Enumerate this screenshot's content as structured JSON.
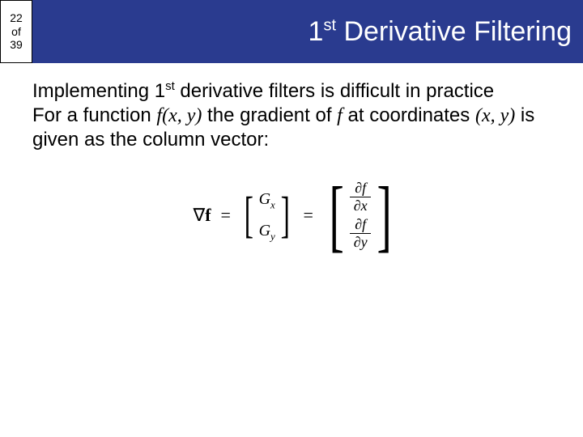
{
  "page_counter": {
    "current": "22",
    "of": "of",
    "total": "39"
  },
  "title": {
    "base1": "1",
    "sup": "st",
    "rest": " Derivative Filtering"
  },
  "body": {
    "line1a": "Implementing 1",
    "line1sup": "st",
    "line1b": " derivative filters is difficult in practice",
    "line2a": "For a function ",
    "fxy1": "f(x, y)",
    "line2b": " the gradient of ",
    "fsingle": "f",
    "line2c": " at coordinates ",
    "xy": "(x, y)",
    "line2d": " is given as the column vector:"
  },
  "equation": {
    "nabla": "∇",
    "f": "f",
    "eq": "=",
    "Gx": "G",
    "x": "x",
    "Gy": "G",
    "y": "y",
    "partial": "∂",
    "fvar": "f",
    "xv": "x",
    "yv": "y"
  }
}
